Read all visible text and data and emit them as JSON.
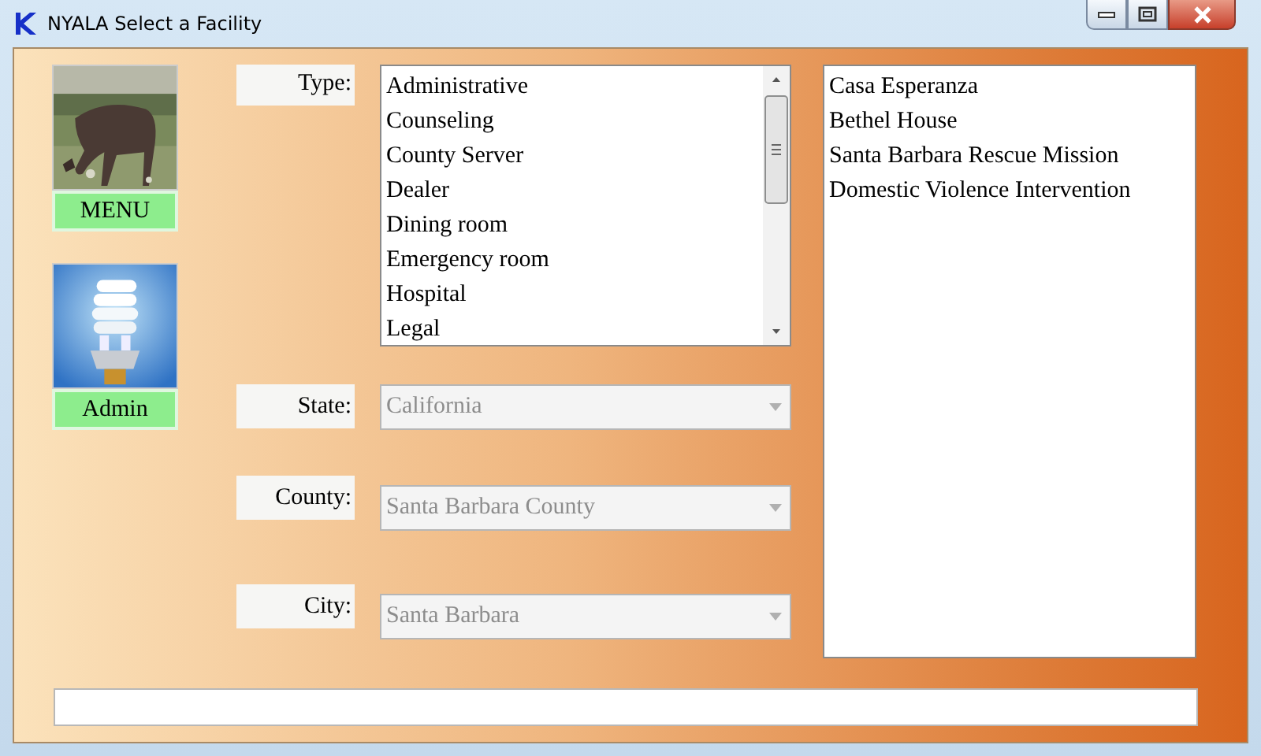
{
  "window": {
    "title": "NYALA Select a Facility"
  },
  "tiles": [
    {
      "kind": "picture",
      "label": "MENU"
    },
    {
      "kind": "picture",
      "label": "Admin"
    }
  ],
  "type": {
    "label": "Type:",
    "items": [
      {
        "text": "Administrative",
        "selected": false
      },
      {
        "text": "Counseling",
        "selected": false
      },
      {
        "text": "County Server",
        "selected": false
      },
      {
        "text": "Dealer",
        "selected": false
      },
      {
        "text": "Dining room",
        "selected": false
      },
      {
        "text": "Emergency room",
        "selected": false
      },
      {
        "text": "Hospital",
        "selected": false
      },
      {
        "text": "Legal",
        "selected": false
      }
    ]
  },
  "filters": [
    {
      "label": "State:",
      "value": "California",
      "disabled": true
    },
    {
      "label": "County:",
      "value": "Santa Barbara County",
      "disabled": true
    },
    {
      "label": "City:",
      "value": "Santa Barbara",
      "disabled": true
    }
  ],
  "facilities": [
    {
      "text": "Casa Esperanza",
      "selected": false
    },
    {
      "text": "Bethel House",
      "selected": false
    },
    {
      "text": "Santa Barbara Rescue Mission",
      "selected": false
    },
    {
      "text": "Domestic Violence Intervention",
      "selected": false
    }
  ]
}
